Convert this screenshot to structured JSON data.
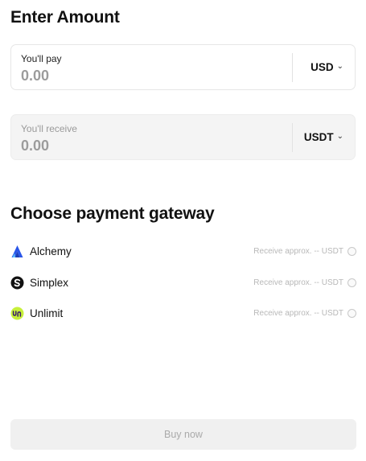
{
  "enter_amount": {
    "title": "Enter Amount",
    "pay": {
      "label": "You'll pay",
      "placeholder": "0.00",
      "currency": "USD"
    },
    "receive": {
      "label": "You'll receive",
      "placeholder": "0.00",
      "currency": "USDT"
    }
  },
  "gateways": {
    "title": "Choose payment gateway",
    "items": [
      {
        "name": "Alchemy",
        "receive_text": "Receive approx. -- USDT",
        "icon": "alchemy-logo-icon",
        "icon_color": "#2a56e8"
      },
      {
        "name": "Simplex",
        "receive_text": "Receive approx. -- USDT",
        "icon": "simplex-logo-icon",
        "icon_color": "#111111"
      },
      {
        "name": "Unlimit",
        "receive_text": "Receive approx. -- USDT",
        "icon": "unlimit-logo-icon",
        "icon_color": "#c7f03a"
      }
    ]
  },
  "buy_button": {
    "label": "Buy now",
    "state": "disabled"
  }
}
